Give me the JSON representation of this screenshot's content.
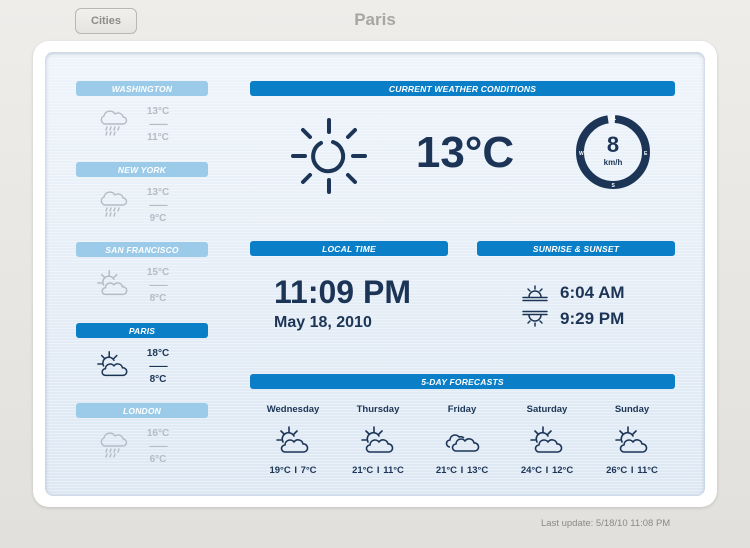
{
  "header": {
    "cities_button": "Cities",
    "title": "Paris"
  },
  "cities": [
    {
      "name": "WASHINGTON",
      "high": "13°C",
      "low": "11°C",
      "separator": "---------",
      "icon": "rain-cloud-icon",
      "selected": false
    },
    {
      "name": "NEW YORK",
      "high": "13°C",
      "low": "9°C",
      "separator": "---------",
      "icon": "rain-cloud-icon",
      "selected": false
    },
    {
      "name": "SAN FRANCISCO",
      "high": "15°C",
      "low": "8°C",
      "separator": "---------",
      "icon": "partly-cloudy-icon",
      "selected": false
    },
    {
      "name": "PARIS",
      "high": "18°C",
      "low": "8°C",
      "separator": "---------",
      "icon": "partly-cloudy-icon",
      "selected": true
    },
    {
      "name": "LONDON",
      "high": "16°C",
      "low": "6°C",
      "separator": "---------",
      "icon": "rain-cloud-icon",
      "selected": false
    }
  ],
  "current": {
    "header": "CURRENT WEATHER CONDITIONS",
    "icon": "sun-icon",
    "temperature": "13°C",
    "wind": {
      "speed": "8",
      "unit": "km/h",
      "directions": {
        "w": "W",
        "e": "E",
        "s": "S"
      },
      "direction": "N"
    }
  },
  "local_time": {
    "header": "LOCAL TIME",
    "time": "11:09 PM",
    "date": "May 18, 2010"
  },
  "sun": {
    "header": "SUNRISE & SUNSET",
    "sunrise": "6:04 AM",
    "sunset": "9:29 PM"
  },
  "forecast": {
    "header": "5-DAY FORECASTS",
    "days": [
      {
        "day": "Wednesday",
        "temps": "19°C  I  7°C",
        "icon": "partly-cloudy-icon"
      },
      {
        "day": "Thursday",
        "temps": "21°C  I  11°C",
        "icon": "partly-cloudy-icon"
      },
      {
        "day": "Friday",
        "temps": "21°C  I  13°C",
        "icon": "cloudy-icon"
      },
      {
        "day": "Saturday",
        "temps": "24°C  I  12°C",
        "icon": "partly-cloudy-icon"
      },
      {
        "day": "Sunday",
        "temps": "26°C  I  11°C",
        "icon": "partly-cloudy-icon"
      }
    ]
  },
  "footer": {
    "last_update": "Last update: 5/18/10 11:08 PM"
  },
  "colors": {
    "header_active": "#0a7fc7",
    "header_inactive": "#9ccbe9",
    "text_dark": "#1c3556",
    "text_dim": "#b4bcc6"
  }
}
